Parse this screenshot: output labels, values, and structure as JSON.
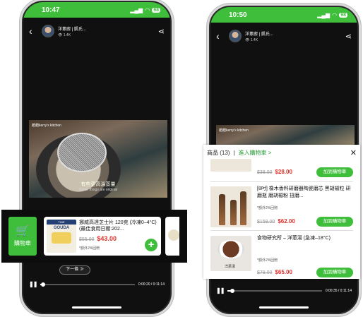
{
  "left": {
    "status": {
      "time": "10:47",
      "battery": "98"
    },
    "uploader": {
      "name": "洋蔥廚 | 凱氏...",
      "views": "1.4K"
    },
    "video": {
      "watermark": "趙趙kerry's kitchen",
      "caption_cn": "有些更高溫蒸量",
      "caption_en": "Some things are original"
    },
    "cart_tile_label": "購物車",
    "product": {
      "image_brand": "TINE",
      "image_label": "GOUDA",
      "title": "挪威高達芝士片 120克 (冷凍0–4°C) (最佳食用日期:202...",
      "old_price": "$55.00",
      "new_price": "$43.00",
      "cashback": "*額外2%回贈"
    },
    "next_label": "下一條 ≫",
    "progress": {
      "time": "0:00:20 / 0:11:14",
      "fraction": 0.03
    }
  },
  "right": {
    "status": {
      "time": "10:50",
      "battery": "98"
    },
    "uploader": {
      "name": "洋蔥廚 | 凱氏...",
      "views": "1.4K"
    },
    "video": {
      "watermark": "趙趙kerry's kitchen"
    },
    "panel": {
      "count_label": "商品 (13)",
      "separator": "|",
      "go_cart": "進入購物車 >",
      "items": [
        {
          "title": "",
          "cashback": "",
          "old_price": "$38.00",
          "new_price": "$28.00",
          "button": "加到購物車"
        },
        {
          "title": "[8吋] 橡木香料研磨器陶瓷磨芯 黑胡椒粒 研磨瓶 磨胡椒粉 扭磨...",
          "cashback": "*額外2%回贈",
          "old_price": "$159.00",
          "new_price": "$62.00",
          "button": "加到購物車"
        },
        {
          "title": "食物研究所 – 洋蔥湯 (急凍–18°C)",
          "cashback": "*額外2%回贈",
          "old_price": "$78.00",
          "new_price": "$65.00",
          "button": "加到購物車"
        }
      ],
      "bowl_tag": "洋蔥湯"
    },
    "progress": {
      "time": "0:00:35 / 0:11:14",
      "fraction": 0.05
    }
  },
  "colors": {
    "accent": "#3fbe3b",
    "price": "#e0312b",
    "link": "#2e9e3c"
  }
}
